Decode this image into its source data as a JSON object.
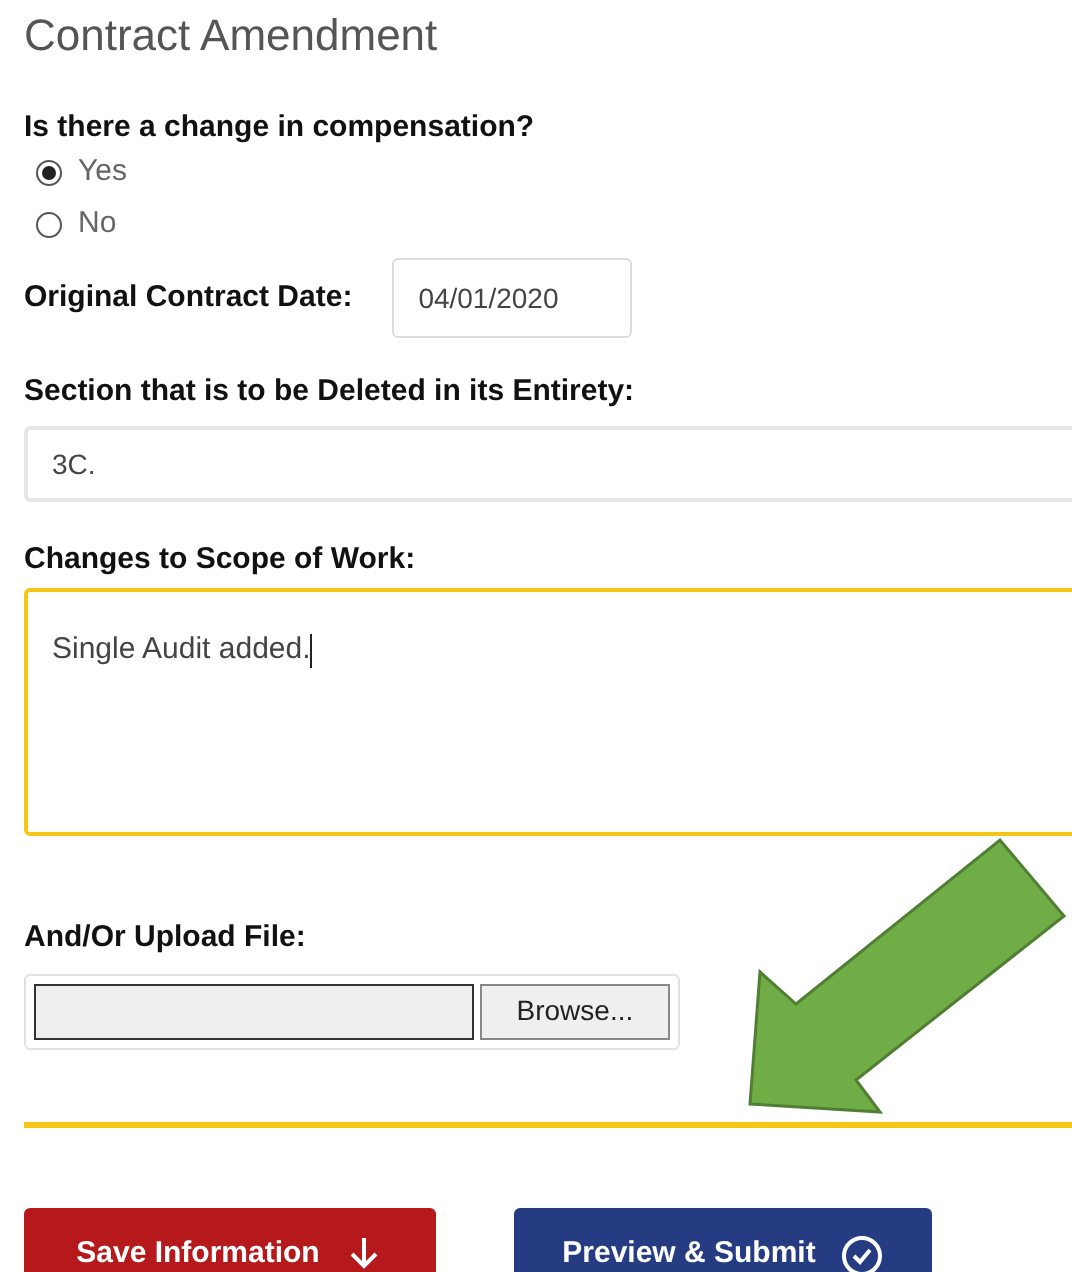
{
  "title": "Contract Amendment",
  "compensation": {
    "label": "Is there a change in compensation?",
    "options": [
      {
        "label": "Yes",
        "selected": true
      },
      {
        "label": "No",
        "selected": false
      }
    ]
  },
  "original_date": {
    "label": "Original Contract Date:",
    "value": "04/01/2020"
  },
  "deleted_section": {
    "label": "Section that is to be Deleted in its Entirety:",
    "value": "3C."
  },
  "scope_changes": {
    "label": "Changes to Scope of Work:",
    "value": "Single Audit added.",
    "focused": true
  },
  "upload": {
    "label": "And/Or Upload File:",
    "button": "Browse..."
  },
  "buttons": [
    {
      "label": "Save Information",
      "kind": "save"
    },
    {
      "label": "Preview & Submit",
      "kind": "submit"
    }
  ]
}
